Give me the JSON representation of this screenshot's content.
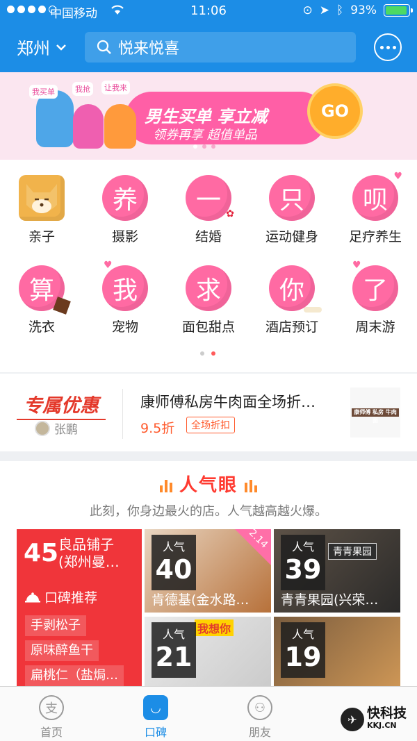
{
  "status": {
    "carrier": "中国移动",
    "time": "11:06",
    "battery": "93%",
    "battery_level": 0.93
  },
  "header": {
    "city": "郑州",
    "search_placeholder": "悦来悦喜",
    "more_icon": "more-icon"
  },
  "banner": {
    "title": "男生买单 享立减",
    "subtitle": "领券再享 超值单品",
    "go": "GO",
    "tags": [
      "我买单",
      "我抢",
      "让我来"
    ],
    "pages": 3,
    "active_page": 0
  },
  "categories": [
    {
      "label": "亲子",
      "glyph": "",
      "icon": "shiba-dog-icon"
    },
    {
      "label": "摄影",
      "glyph": "养",
      "icon": "heart-bubble-icon"
    },
    {
      "label": "结婚",
      "glyph": "一",
      "icon": "rose-bubble-icon"
    },
    {
      "label": "运动健身",
      "glyph": "只",
      "icon": "bubble-icon"
    },
    {
      "label": "足疗养生",
      "glyph": "呗",
      "icon": "heart-bubble-icon"
    },
    {
      "label": "洗衣",
      "glyph": "算",
      "icon": "chocolate-bubble-icon"
    },
    {
      "label": "宠物",
      "glyph": "我",
      "icon": "heart-bubble-icon"
    },
    {
      "label": "面包甜点",
      "glyph": "求",
      "icon": "bubble-icon"
    },
    {
      "label": "酒店预订",
      "glyph": "你",
      "icon": "bone-bubble-icon"
    },
    {
      "label": "周末游",
      "glyph": "了",
      "icon": "heart-bubble-icon"
    }
  ],
  "grid_pager": {
    "pages": 2,
    "active_page": 1
  },
  "promo": {
    "logo": "专属优惠",
    "person": "张鹏",
    "title": "康师傅私房牛肉面全场折…",
    "price": "9.5折",
    "badge": "全场折扣",
    "image_text": "康师傅 私房 牛肉面"
  },
  "popular": {
    "title": "人气眼",
    "subtitle": "此刻，你身边最火的店。人气越高越火爆。",
    "featured": {
      "score": "45",
      "name_line1": "良品铺子",
      "name_line2": "(郑州曼…",
      "rec_label": "口碑推荐",
      "dishes": [
        "手剥松子",
        "原味醉鱼干",
        "扁桃仁（盐焗…"
      ]
    },
    "tiles": [
      {
        "label": "人气",
        "score": "40",
        "name": "肯德基(金水路…",
        "corner": "2.14"
      },
      {
        "label": "人气",
        "score": "39",
        "name": "青青果园(兴荣…",
        "sign": "青青果园"
      },
      {
        "label": "人气",
        "score": "21",
        "name": "",
        "pkg": "我想你"
      },
      {
        "label": "人气",
        "score": "19",
        "name": ""
      }
    ]
  },
  "tabs": [
    {
      "label": "首页",
      "glyph": "支",
      "icon": "alipay-icon",
      "active": false
    },
    {
      "label": "口碑",
      "glyph": "◡",
      "icon": "koubei-icon",
      "active": true
    },
    {
      "label": "朋友",
      "glyph": "⚇",
      "icon": "friends-icon",
      "active": false
    }
  ],
  "watermark": {
    "brand": "快科技",
    "domain": "KKJ.CN"
  }
}
